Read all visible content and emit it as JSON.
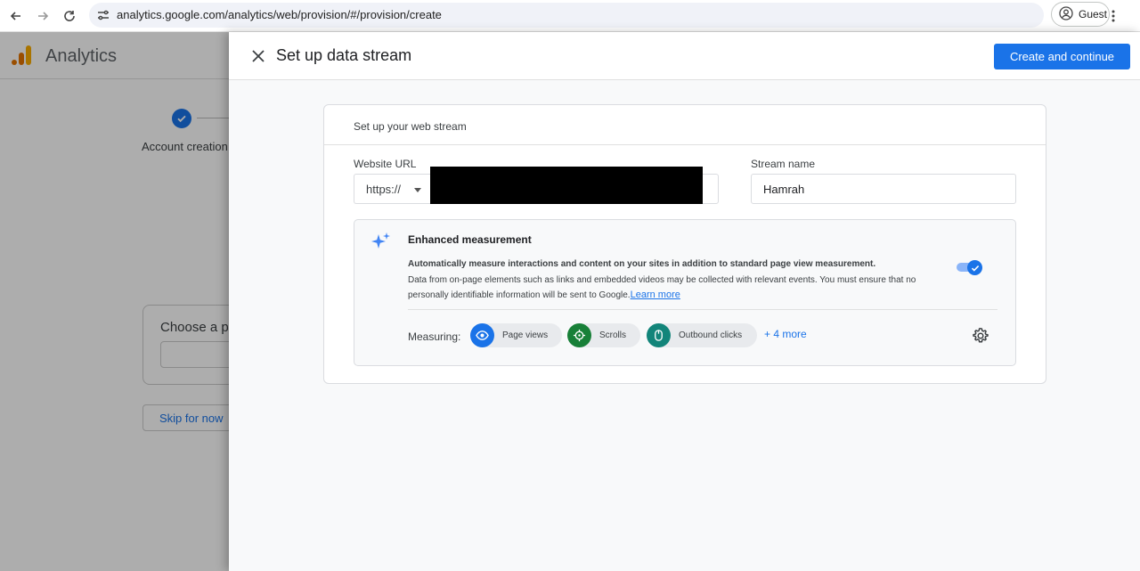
{
  "browser": {
    "url": "analytics.google.com/analytics/web/provision/#/provision/create",
    "profile_label": "Guest"
  },
  "background_page": {
    "app_title": "Analytics",
    "step_label": "Account creation",
    "platform_prompt": "Choose a pla",
    "skip_label": "Skip for now"
  },
  "panel": {
    "title": "Set up data stream",
    "create_label": "Create and continue",
    "card_title": "Set up your web stream",
    "website_url_label": "Website URL",
    "protocol": "https://",
    "stream_name_label": "Stream name",
    "stream_name_value": "Hamrah",
    "enhanced": {
      "title": "Enhanced measurement",
      "desc_bold": "Automatically measure interactions and content on your sites in addition to standard page view measurement.",
      "desc": "Data from on-page elements such as links and embedded videos may be collected with relevant events. You must ensure that no personally identifiable information will be sent to Google.",
      "learn_more": "Learn more",
      "toggle_on": true,
      "measuring_label": "Measuring:",
      "chips": [
        {
          "label": "Page views",
          "icon": "eye-icon",
          "color": "#1a73e8"
        },
        {
          "label": "Scrolls",
          "icon": "crosshair-icon",
          "color": "#188038"
        },
        {
          "label": "Outbound clicks",
          "icon": "mouse-icon",
          "color": "#12857a"
        }
      ],
      "more_label": "+ 4 more"
    }
  },
  "colors": {
    "accent": "#1a73e8"
  }
}
